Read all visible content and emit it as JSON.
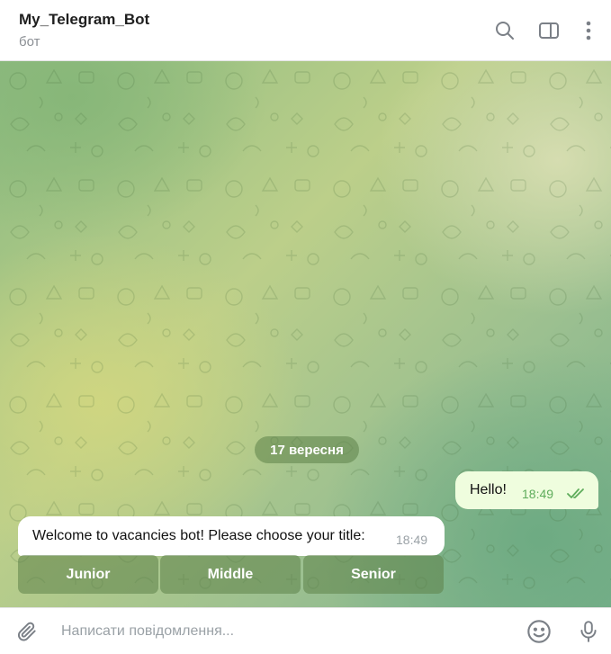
{
  "header": {
    "title": "My_Telegram_Bot",
    "status": "бот",
    "icons": [
      "search-icon",
      "sidebar-panel-icon",
      "more-vertical-icon"
    ]
  },
  "chat": {
    "date_separator": "17 вересня",
    "outgoing": {
      "text": "Hello!",
      "time": "18:49",
      "status": "read"
    },
    "incoming": {
      "text": "Welcome to vacancies bot! Please choose your title:",
      "time": "18:49"
    },
    "keyboard": [
      {
        "label": "Junior"
      },
      {
        "label": "Middle"
      },
      {
        "label": "Senior"
      }
    ]
  },
  "composer": {
    "placeholder": "Написати повідомлення...",
    "icons": [
      "attach-icon",
      "emoji-icon",
      "microphone-icon"
    ]
  },
  "colors": {
    "accent": "#5eac5b",
    "outgoing_bubble": "#effdde",
    "incoming_bubble": "#ffffff",
    "icon_gray": "#7b8087"
  }
}
